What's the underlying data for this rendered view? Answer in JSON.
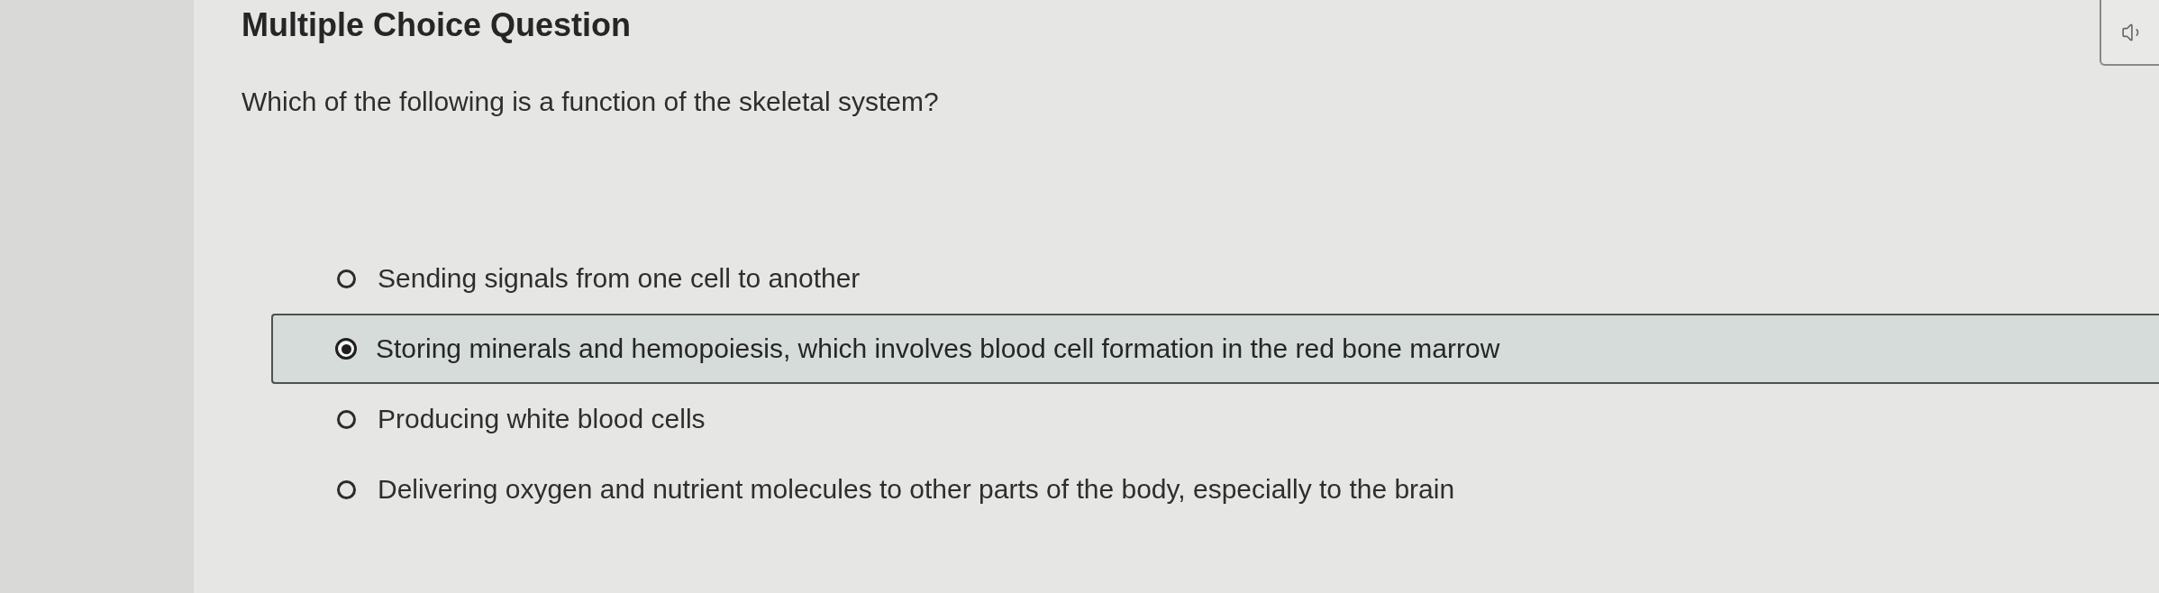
{
  "title": "Multiple Choice Question",
  "question": "Which of the following is a function of the skeletal system?",
  "options": [
    {
      "label": "Sending signals from one cell to another",
      "selected": false
    },
    {
      "label": "Storing minerals and hemopoiesis, which involves blood cell formation in the red bone marrow",
      "selected": true
    },
    {
      "label": "Producing white blood cells",
      "selected": false
    },
    {
      "label": "Delivering oxygen and nutrient molecules to other parts of the body, especially to the brain",
      "selected": false
    }
  ]
}
